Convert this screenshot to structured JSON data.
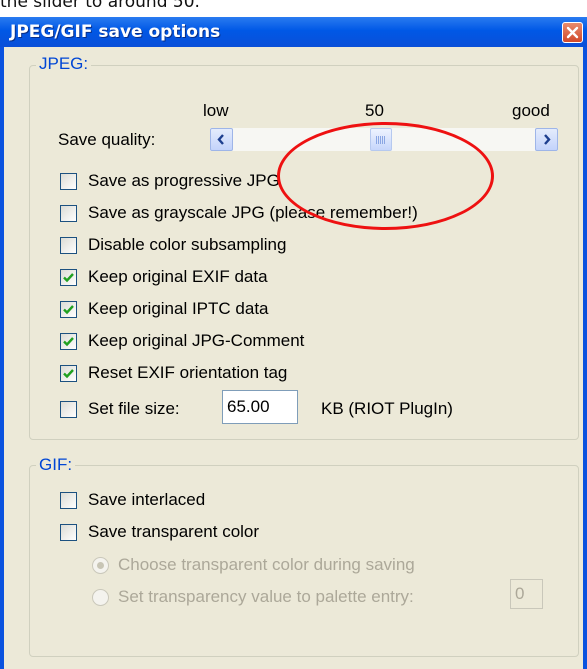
{
  "caption": "the slider to around 50.",
  "window": {
    "title": "JPEG/GIF save options"
  },
  "jpeg": {
    "legend": "JPEG:",
    "quality": {
      "label": "Save quality:",
      "low_label": "low",
      "high_label": "good",
      "value_label": "50",
      "value": 50
    },
    "options": [
      {
        "label": "Save as progressive JPG",
        "checked": false
      },
      {
        "label": "Save as grayscale JPG (please remember!)",
        "checked": false
      },
      {
        "label": "Disable color subsampling",
        "checked": false
      },
      {
        "label": "Keep original EXIF data",
        "checked": true
      },
      {
        "label": "Keep original IPTC data",
        "checked": true
      },
      {
        "label": "Keep original JPG-Comment",
        "checked": true
      },
      {
        "label": "Reset EXIF orientation tag",
        "checked": true
      }
    ],
    "file_size": {
      "label": "Set file size:",
      "checked": false,
      "value": "65.00",
      "unit": "KB (RIOT PlugIn)"
    }
  },
  "gif": {
    "legend": "GIF:",
    "interlaced": {
      "label": "Save interlaced",
      "checked": false
    },
    "transparent": {
      "label": "Save transparent color",
      "checked": false
    },
    "radio_choose": {
      "label": "Choose transparent color during saving",
      "selected": true
    },
    "radio_palette": {
      "label": "Set transparency value to palette entry:",
      "selected": false,
      "value": "0"
    }
  },
  "colors": {
    "titlebar": "#0058e6",
    "highlight": "#ee1111",
    "legend_text": "#0046d5",
    "disabled_text": "#aca899"
  }
}
